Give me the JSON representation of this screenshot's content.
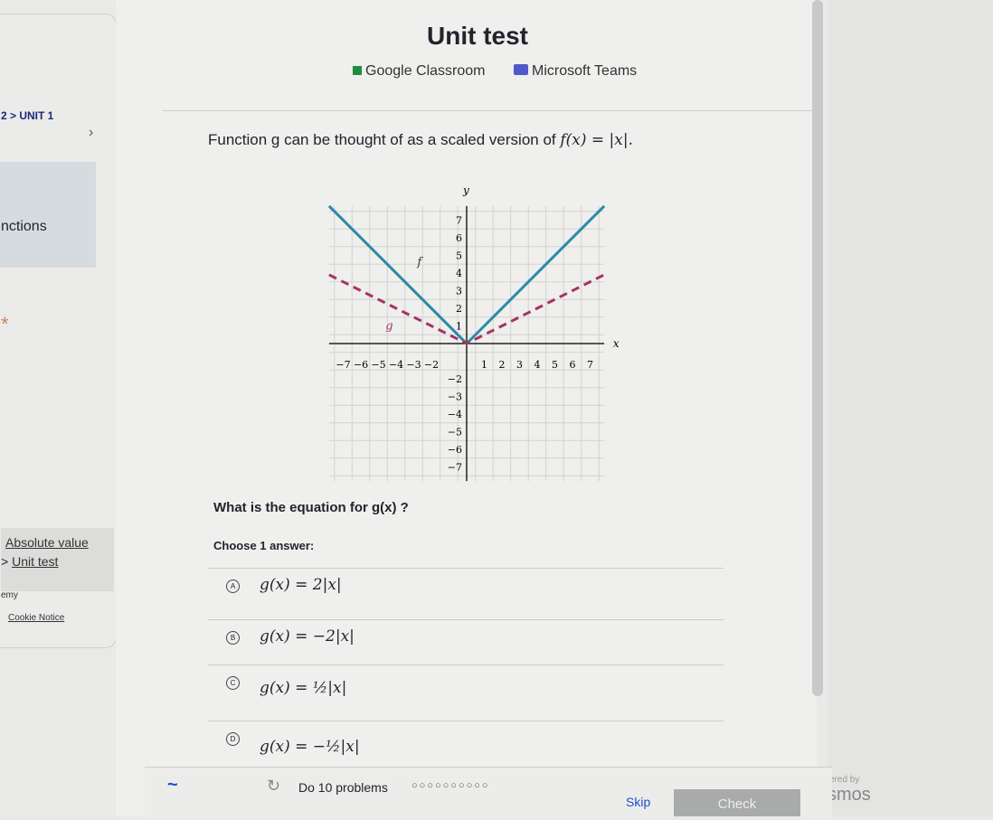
{
  "header": {
    "title": "Unit test",
    "google_classroom": "Google Classroom",
    "microsoft_teams": "Microsoft Teams"
  },
  "sidebar": {
    "breadcrumb": "2 > UNIT 1",
    "unit_label": "nctions",
    "links": [
      "Absolute value",
      "Unit test"
    ],
    "link_sep": ">",
    "footer_brand": "emy",
    "cookie_notice": "Cookie Notice"
  },
  "question": {
    "prompt_prefix": "Function g can be thought of as a scaled version of ",
    "prompt_math": "f(x) = |x|.",
    "ask": "What is the equation for g(x) ?",
    "choose": "Choose 1 answer:",
    "options": [
      {
        "letter": "A",
        "eq": "g(x) = 2|x|"
      },
      {
        "letter": "B",
        "eq": "g(x) = −2|x|"
      },
      {
        "letter": "C",
        "eq": "g(x) = ½|x|"
      },
      {
        "letter": "D",
        "eq": "g(x) = −½|x|"
      }
    ]
  },
  "footer": {
    "progress_label": "Do 10 problems",
    "total": 10,
    "completed": 0,
    "skip": "Skip",
    "check": "Check",
    "powered_by": "ered by",
    "desmos": "smos"
  },
  "chart_data": {
    "type": "line",
    "xlabel": "x",
    "ylabel": "y",
    "xlim": [
      -7.8,
      8
    ],
    "ylim": [
      -7.8,
      8
    ],
    "grid": true,
    "xticks": [
      -7,
      -6,
      -5,
      -4,
      -3,
      -2,
      1,
      2,
      3,
      4,
      5,
      6,
      7
    ],
    "yticks": [
      -7,
      -6,
      -5,
      -4,
      -3,
      -2,
      1,
      2,
      3,
      4,
      5,
      6,
      7
    ],
    "series": [
      {
        "name": "f",
        "style": "solid",
        "color": "#2a8aa8",
        "x": [
          -7.8,
          0,
          7.8
        ],
        "y": [
          7.8,
          0,
          7.8
        ]
      },
      {
        "name": "g",
        "style": "dashed",
        "color": "#a5345f",
        "x": [
          -7.8,
          0,
          7.8
        ],
        "y": [
          3.9,
          0,
          3.9
        ]
      }
    ]
  }
}
